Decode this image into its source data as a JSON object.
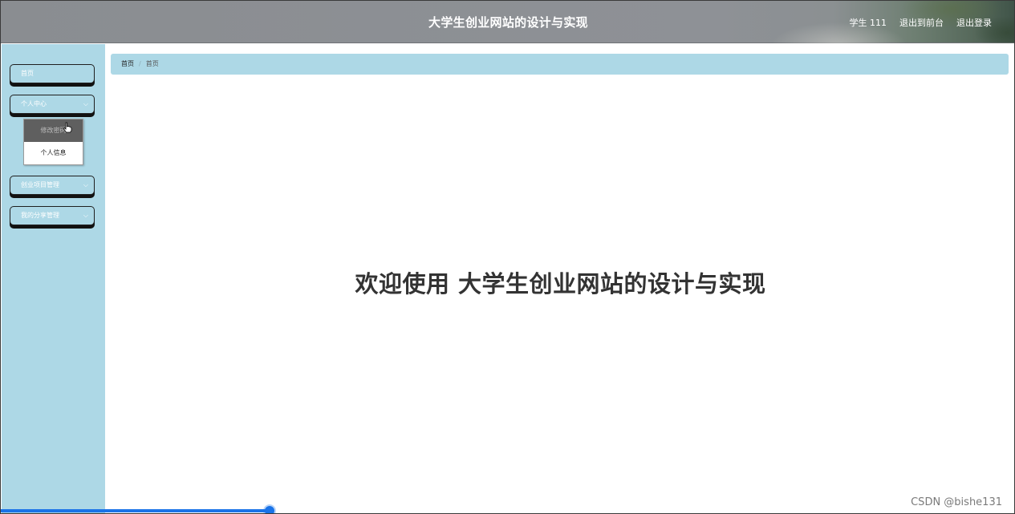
{
  "header": {
    "title": "大学生创业网站的设计与实现",
    "user_label": "学生 111",
    "front_link": "退出到前台",
    "logout_link": "退出登录"
  },
  "sidebar": {
    "items": [
      {
        "label": "首页",
        "has_chevron": false
      },
      {
        "label": "个人中心",
        "has_chevron": true,
        "expanded": true
      },
      {
        "label": "创业项目管理",
        "has_chevron": true
      },
      {
        "label": "我的分享管理",
        "has_chevron": true
      }
    ],
    "submenu": [
      {
        "label": "修改密码",
        "hovered": true
      },
      {
        "label": "个人信息",
        "hovered": false
      }
    ],
    "chevron_icon": "chevron-down-icon"
  },
  "breadcrumb": {
    "home": "首页",
    "separator": "/",
    "current": "首页"
  },
  "main": {
    "welcome": "欢迎使用 大学生创业网站的设计与实现"
  },
  "watermark": "CSDN @bishe131",
  "video_progress": 0.265,
  "colors": {
    "sidebar_bg": "#add8e6",
    "header_bg": "#8e9196",
    "progress": "#1a73e8"
  }
}
